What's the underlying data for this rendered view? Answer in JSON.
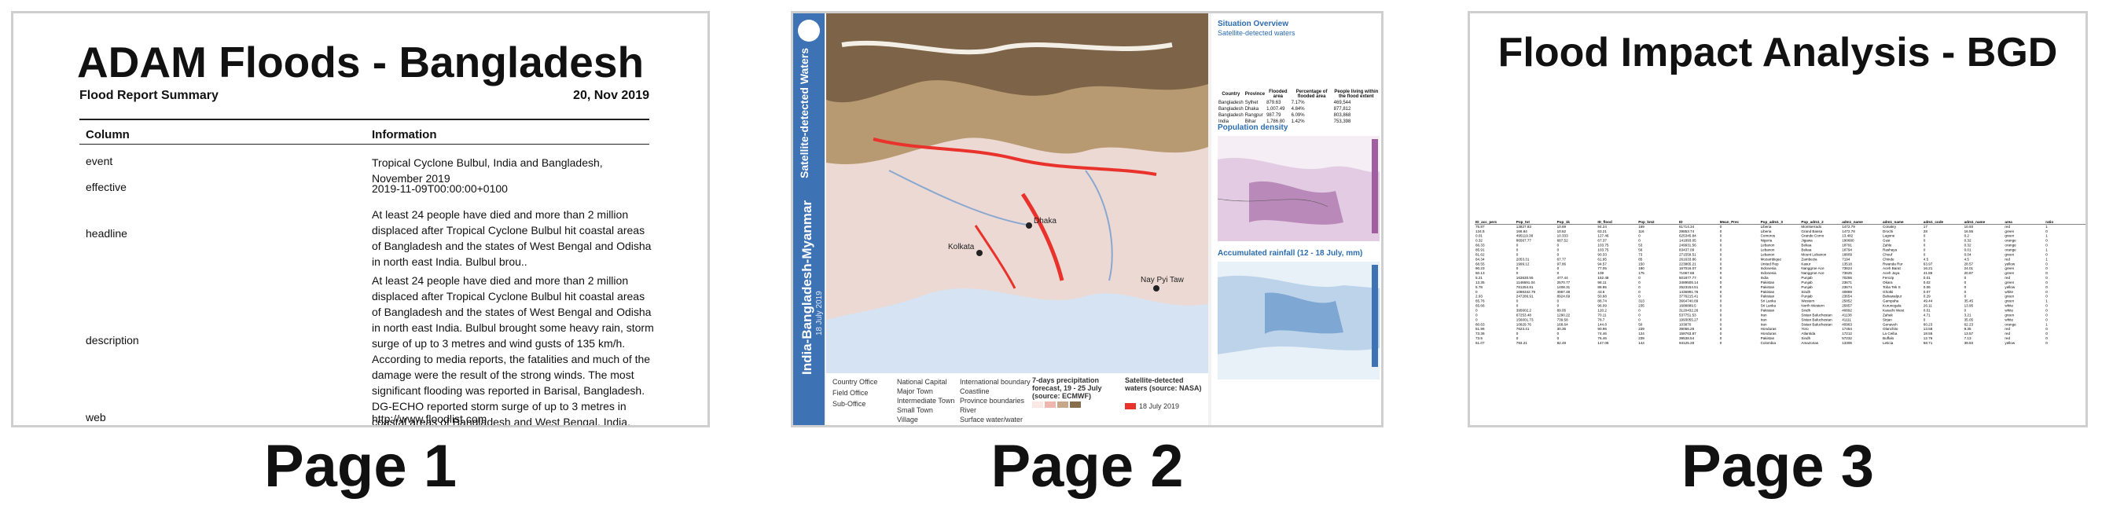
{
  "page1": {
    "title": "ADAM Floods - Bangladesh",
    "subtitle": "Flood Report Summary",
    "date": "20, Nov 2019",
    "col_header": "Column",
    "info_header": "Information",
    "rows": [
      {
        "key": "event",
        "value": "Tropical Cyclone Bulbul, India and Bangladesh, November 2019"
      },
      {
        "key": "effective",
        "value": "2019-11-09T00:00:00+0100"
      },
      {
        "key": "headline",
        "value": "At least 24 people have died and more than 2 million displaced after Tropical Cyclone Bulbul hit coastal areas of Bangladesh and the states of West Bengal and Odisha in north east India. Bulbul brou.."
      },
      {
        "key": "description",
        "value": "At least 24 people have died and more than 2 million displaced after Tropical Cyclone Bulbul hit coastal areas of Bangladesh and the states of West Bengal and Odisha in north east India. Bulbul brought some heavy rain, storm surge of up to 3 metres and wind gusts of 135 km/h. According to media reports, the fatalities and much of the damage were the result of the strong winds. The most significant flooding was reported in Barisal, Bangladesh. DG-ECHO reported storm surge of up to 3 metres in coastal areas of Bangladesh and West Bengal, India."
      },
      {
        "key": "web",
        "value": "http://www.floodlist.com"
      }
    ]
  },
  "page2": {
    "side_top": "Satellite-detected Waters",
    "side_main": "India-Bangladesh-Myanmar",
    "side_date": "18 July 2019",
    "overview_title": "Situation Overview",
    "overview_sub": "Satellite-detected waters",
    "population_title": "Population density",
    "rainfall_title": "Accumulated rainfall (12 - 18 July, mm)",
    "forecast_title": "7-days precipitation forecast, 19 - 25 July (source: ECMWF)",
    "satellite_title": "Satellite-detected waters (source: NASA)",
    "satellite_date": "18 July 2019",
    "legend_items": [
      "Country Office",
      "Field Office",
      "Sub-Office",
      "National Capital",
      "Major Town",
      "Intermediate Town",
      "Small Town",
      "Village",
      "International boundary",
      "Coastline",
      "Province boundaries",
      "River",
      "Surface water/water"
    ],
    "map_labels": [
      "Dhaka",
      "Kolkata",
      "Nay Pyi Taw"
    ],
    "table_headers": [
      "Country",
      "Province",
      "Flooded area",
      "Percentage of flooded area",
      "People living within the flood extent"
    ],
    "table_rows": [
      [
        "Bangladesh",
        "Sylhet",
        "879.63",
        "7.17%",
        "469,544"
      ],
      [
        "Bangladesh",
        "Dhaka",
        "1,007.49",
        "4.84%",
        "877,812"
      ],
      [
        "Bangladesh",
        "Rangpur",
        "987.79",
        "6.09%",
        "803,868"
      ],
      [
        "India",
        "Bihar",
        "1,786.80",
        "1.42%",
        "753,398"
      ]
    ]
  },
  "page3": {
    "title": "Flood Impact Analysis - BGD",
    "headers": [
      "ID_acc_pers",
      "Pop_tot",
      "Pop_1k",
      "ID_flood",
      "Pop_km2",
      "ID",
      "Mean_Prec",
      "Pop_adm1_3",
      "Pop_adm1_2",
      "adm1_name",
      "adm1_name",
      "adm1_code",
      "adm1_name",
      "area",
      "ratio"
    ],
    "rows": [
      [
        "75.87",
        "13827.83",
        "10.69",
        "94.24",
        "169",
        "61714.34",
        "0",
        "Liberia",
        "Montserrado",
        "1472.79",
        "Conakry",
        "17",
        "10.93",
        "red",
        "1"
      ],
      [
        "134.5",
        "166.64",
        "10.52",
        "63.21",
        "116",
        "29853.74",
        "0",
        "Liberia",
        "Grand Bassa",
        "1472.78",
        "Drochi",
        "28",
        "16.55",
        "green",
        "0"
      ],
      [
        "0.01",
        "495119.38",
        "10.333",
        "127.46",
        "0",
        "625345.84",
        "0",
        "Comoros",
        "Grande Como",
        "13.482",
        "Lagone",
        "0",
        "0.2",
        "green",
        "1"
      ],
      [
        "0.32",
        "86567.77",
        "687.52",
        "67.37",
        "0",
        "141893.05",
        "0",
        "Nigeria",
        "Jigawa",
        "190680",
        "Gusi",
        "0",
        "0.32",
        "orange",
        "0"
      ],
      [
        "66.33",
        "0",
        "0",
        "103.75",
        "53",
        "249931.56",
        "0",
        "Lebanon",
        "Bekaa",
        "18791",
        "Zahle",
        "0",
        "0.32",
        "orange",
        "0"
      ],
      [
        "85.91",
        "0",
        "0",
        "103.75",
        "56",
        "83437.09",
        "0",
        "Lebanon",
        "Bekaa",
        "18794",
        "Rashaya",
        "0",
        "0.01",
        "orange",
        "1"
      ],
      [
        "81.62",
        "0",
        "0",
        "90.33",
        "73",
        "271559.51",
        "0",
        "Lebanon",
        "Mount Lebanon",
        "18809",
        "Chouf",
        "0",
        "0.04",
        "green",
        "0"
      ],
      [
        "84.34",
        "2053.31",
        "67.77",
        "61.95",
        "85",
        "261633.86",
        "0",
        "Mozambique",
        "Zambezia",
        "7194",
        "Chinde",
        "4.5",
        "4.5",
        "red",
        "1"
      ],
      [
        "68.55",
        "1999.12",
        "97.86",
        "94.57",
        "150",
        "223865.21",
        "0",
        "United Rep",
        "Kasur",
        "13518",
        "Rwanda Rur",
        "63.97",
        "28.57",
        "yellow",
        "0"
      ],
      [
        "90.23",
        "0",
        "0",
        "77.05",
        "180",
        "167016.07",
        "0",
        "Indonesia",
        "Nanggroe Ace",
        "73624",
        "Aceh Barat",
        "16.21",
        "24.01",
        "green",
        "0"
      ],
      [
        "60.13",
        "0",
        "0",
        "109",
        "175",
        "71067.68",
        "0",
        "Indonesia",
        "Nanggroe Ace",
        "73625",
        "Aceh Jaya",
        "41.86",
        "20.87",
        "green",
        "0"
      ],
      [
        "5.21",
        "163630.55",
        "477.44",
        "152.48",
        "0",
        "501877.77",
        "0",
        "India",
        "Punjab",
        "70255",
        "Ferozp",
        "0.01",
        "0",
        "red",
        "0"
      ],
      [
        "13.35",
        "1146691.04",
        "2570.77",
        "98.11",
        "0",
        "3489505.14",
        "0",
        "Pakistan",
        "Punjab",
        "23671",
        "Okara",
        "0.02",
        "0",
        "green",
        "0"
      ],
      [
        "5.78",
        "761254.81",
        "1408.31",
        "88.95",
        "0",
        "2523154.51",
        "0",
        "Pakistan",
        "Punjab",
        "23674",
        "Toba Tek S",
        "0.06",
        "0",
        "yellow",
        "0"
      ],
      [
        "0",
        "1086342.79",
        "4967.48",
        "43.5",
        "0",
        "1436991.76",
        "0",
        "Pakistan",
        "Sindh",
        "40889",
        "Ghotki",
        "0.07",
        "0",
        "white",
        "0"
      ],
      [
        "2.93",
        "247286.91",
        "8924.69",
        "50.68",
        "0",
        "3776215.41",
        "0",
        "Pakistan",
        "Punjab",
        "23654",
        "Bahawalpur",
        "0.29",
        "0",
        "green",
        "0"
      ],
      [
        "65.76",
        "0",
        "0",
        "88.74",
        "313",
        "3664740.89",
        "0",
        "Sri Lanka",
        "Western",
        "25852",
        "Gampaha",
        "49.44",
        "35.45",
        "green",
        "1"
      ],
      [
        "65.66",
        "0",
        "0",
        "96.09",
        "235",
        "1688889.5",
        "0",
        "Sri Lanka",
        "North Western",
        "25857",
        "Kurunegala",
        "26.11",
        "13.95",
        "white",
        "0"
      ],
      [
        "0",
        "395602.2",
        "89.05",
        "120.2",
        "0",
        "3120432.26",
        "0",
        "Pakistan",
        "Sindh",
        "40892",
        "Karachi West",
        "0.01",
        "0",
        "white",
        "0"
      ],
      [
        "0",
        "67253.48",
        "1290.22",
        "70.11",
        "0",
        "537751.53",
        "0",
        "Iran",
        "Sistan Baluchestan",
        "41138",
        "Zahak",
        "4.71",
        "3.21",
        "green",
        "0"
      ],
      [
        "0",
        "156001.73",
        "739.58",
        "78.7",
        "0",
        "1993055.27",
        "0",
        "Iran",
        "Sistan Baluchestan",
        "41111",
        "Sirjan",
        "0",
        "35.05",
        "white",
        "0"
      ],
      [
        "80.63",
        "10829.76",
        "168.64",
        "144.8",
        "50",
        "103870",
        "0",
        "Iran",
        "Sistan Baluchestan",
        "40963",
        "Genaveh",
        "60.23",
        "62.23",
        "orange",
        "1"
      ],
      [
        "51.96",
        "7623.41",
        "30.36",
        "90.96",
        "239",
        "39066.28",
        "0",
        "Honduras",
        "Yoro",
        "17454",
        "Olanchito",
        "13.58",
        "9.35",
        "red",
        "0"
      ],
      [
        "73.36",
        "0",
        "0",
        "74.46",
        "124",
        "158763.87",
        "0",
        "Honduras",
        "Atlantida",
        "17212",
        "La Ceiba",
        "18.55",
        "13.57",
        "red",
        "0"
      ],
      [
        "73.5",
        "0",
        "0",
        "76.46",
        "239",
        "39538.54",
        "0",
        "Pakistan",
        "Sindh",
        "57232",
        "Buffalo",
        "12.76",
        "7.13",
        "red",
        "0"
      ],
      [
        "61.07",
        "793.21",
        "92.49",
        "147.06",
        "144",
        "94125.28",
        "0",
        "Colombia",
        "Amazonas",
        "13306",
        "Leticia",
        "58.71",
        "39.93",
        "yellow",
        "0"
      ]
    ]
  },
  "labels": {
    "page1": "Page 1",
    "page2": "Page 2",
    "page3": "Page 3"
  }
}
